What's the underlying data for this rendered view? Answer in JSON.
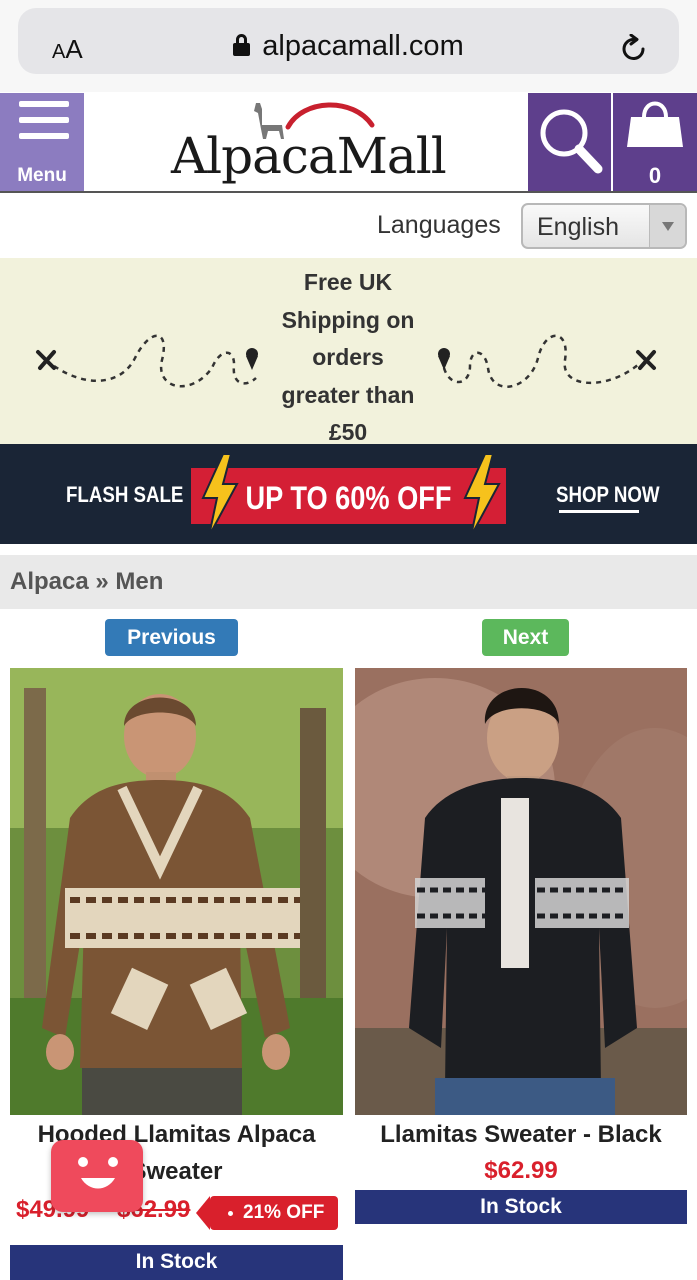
{
  "browser": {
    "text_size_label": "AA",
    "url": "alpacamall.com"
  },
  "header": {
    "menu_label": "Menu",
    "logo_text": "AlpacaMall",
    "cart_count": "0"
  },
  "languages": {
    "label": "Languages",
    "selected": "English"
  },
  "shipping_banner": {
    "lines": [
      "Free UK",
      "Shipping on",
      "orders",
      "greater than",
      "£50"
    ]
  },
  "flash_sale": {
    "left_text": "FLASH SALE",
    "middle_text": "UP TO 60% OFF",
    "right_text": "SHOP NOW"
  },
  "breadcrumb": {
    "text": "Alpaca » Men"
  },
  "pager": {
    "previous": "Previous",
    "next": "Next"
  },
  "products": [
    {
      "title_line1": "Hooded Llamitas Alpaca",
      "title_line2": "Sweater",
      "price": "$49.99",
      "old_price": "$62.99",
      "discount": "21% OFF",
      "stock": "In Stock"
    },
    {
      "title": "Llamitas Sweater - Black",
      "price": "$62.99",
      "stock": "In Stock"
    }
  ],
  "colors": {
    "menu_purple": "#8c7cc0",
    "header_purple": "#5e3f8c",
    "previous_blue": "#337ab7",
    "next_green": "#5cb85c",
    "price_red": "#d9202c",
    "stock_navy": "#27347a",
    "flash_bg": "#1a2536"
  }
}
